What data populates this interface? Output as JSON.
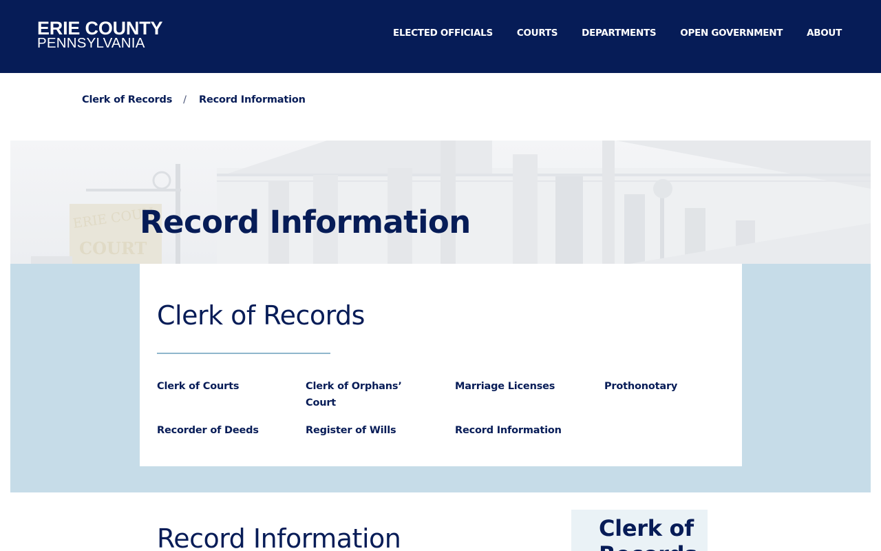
{
  "header": {
    "logo_line1": "ERIE COUNTY",
    "logo_line2": "PENNSYLVANIA",
    "nav": [
      {
        "label": "ELECTED OFFICIALS"
      },
      {
        "label": "COURTS"
      },
      {
        "label": "DEPARTMENTS"
      },
      {
        "label": "OPEN GOVERNMENT"
      },
      {
        "label": "ABOUT"
      }
    ]
  },
  "breadcrumb": {
    "items": [
      "Clerk of Records",
      "Record Information"
    ],
    "separator": "/"
  },
  "hero": {
    "title": "Record Information"
  },
  "card": {
    "title": "Clerk of Records",
    "links": [
      {
        "label": "Clerk of Courts"
      },
      {
        "label": "Clerk of Orphans’ Court"
      },
      {
        "label": "Marriage Licenses"
      },
      {
        "label": "Prothonotary"
      },
      {
        "label": "Recorder of Deeds"
      },
      {
        "label": "Register of Wills"
      },
      {
        "label": "Record Information"
      }
    ]
  },
  "content": {
    "title": "Record Information"
  },
  "sidebar": {
    "title": "Clerk of Records"
  },
  "colors": {
    "navy": "#061c57",
    "band_blue": "#c6dce8",
    "rule_blue": "#8fb6cc",
    "side_box": "#eaf2f6"
  }
}
